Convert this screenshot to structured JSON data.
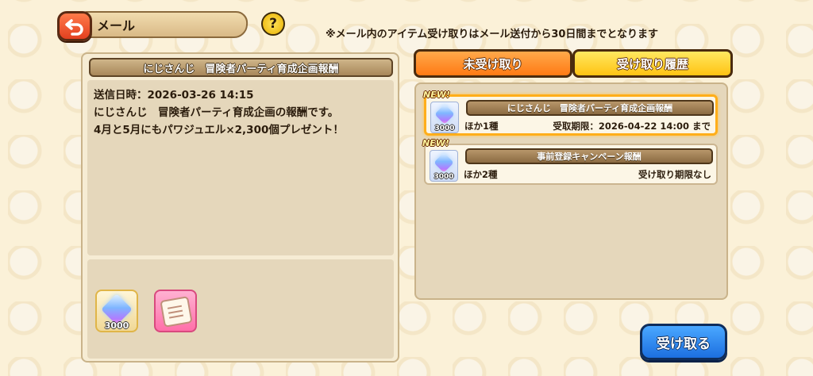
{
  "header": {
    "title": "メール",
    "help_label": "?",
    "notice": "※メール内のアイテム受け取りはメール送付から30日間までとなります"
  },
  "detail": {
    "title": "にじさんじ　冒険者パーティ育成企画報酬",
    "sent_label": "送信日時：2026-03-26 14:15",
    "body": "にじさんじ　冒険者パーティ育成企画の報酬です。\n4月と5月にもパワジュエル×2,300個プレゼント！",
    "items": [
      {
        "icon": "jewel-icon",
        "quantity": "3000"
      },
      {
        "icon": "scroll-ticket-icon",
        "quantity": ""
      }
    ]
  },
  "tabs": {
    "unreceived": "未受け取り",
    "history": "受け取り履歴"
  },
  "mail_list": [
    {
      "badge": "NEW!",
      "title": "にじさんじ　冒険者パーティ育成企画報酬",
      "quantity": "3000",
      "extra": "ほか1種",
      "deadline": "受取期限：2026-04-22 14:00 まで",
      "selected": true
    },
    {
      "badge": "NEW!",
      "title": "事前登録キャンペーン報酬",
      "quantity": "3000",
      "extra": "ほか2種",
      "deadline": "受け取り期限なし",
      "selected": false
    }
  ],
  "actions": {
    "receive": "受け取る"
  },
  "colors": {
    "background": "#fbf1d8",
    "tab_active": "#ff8a1f",
    "tab_inactive": "#ffd21f",
    "receive_button": "#2a86f0",
    "back_button": "#f0562a"
  }
}
